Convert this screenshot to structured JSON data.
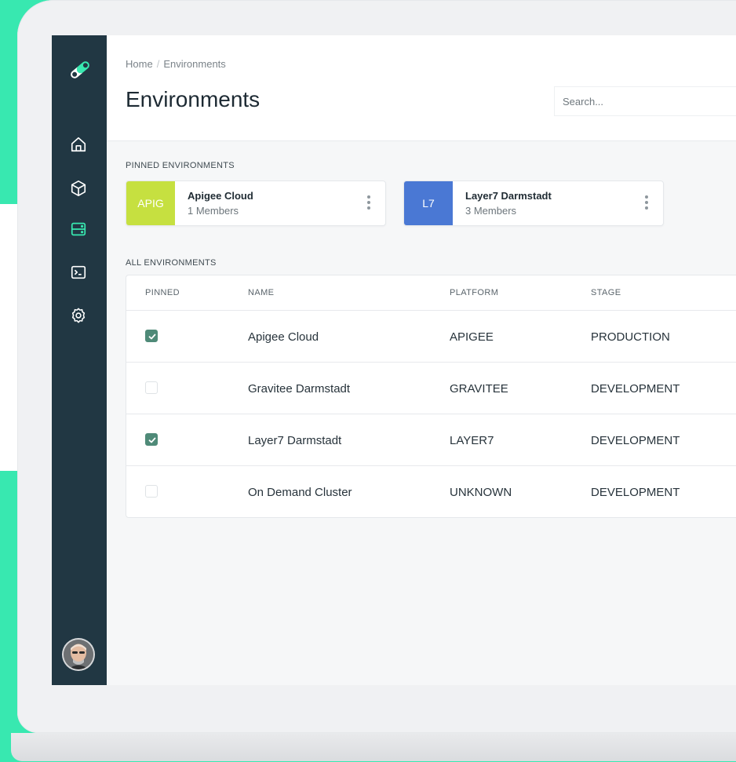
{
  "breadcrumb": {
    "home": "Home",
    "separator": "/",
    "current": "Environments"
  },
  "page": {
    "title": "Environments"
  },
  "search": {
    "placeholder": "Search..."
  },
  "sidebar": {
    "items": [
      {
        "icon": "home-icon"
      },
      {
        "icon": "cube-icon"
      },
      {
        "icon": "server-icon",
        "active": true
      },
      {
        "icon": "terminal-icon"
      },
      {
        "icon": "settings-icon"
      }
    ]
  },
  "pinned": {
    "label": "PINNED ENVIRONMENTS",
    "cards": [
      {
        "badge": "APIG",
        "name": "Apigee Cloud",
        "members": "1 Members",
        "color": "#c6e040"
      },
      {
        "badge": "L7",
        "name": "Layer7 Darmstadt",
        "members": "3 Members",
        "color": "#4a78d4"
      }
    ]
  },
  "all": {
    "label": "ALL ENVIRONMENTS",
    "columns": [
      "PINNED",
      "NAME",
      "PLATFORM",
      "STAGE"
    ],
    "rows": [
      {
        "pinned": true,
        "name": "Apigee Cloud",
        "platform": "APIGEE",
        "stage": "PRODUCTION"
      },
      {
        "pinned": false,
        "name": "Gravitee Darmstadt",
        "platform": "GRAVITEE",
        "stage": "DEVELOPMENT"
      },
      {
        "pinned": true,
        "name": "Layer7 Darmstadt",
        "platform": "LAYER7",
        "stage": "DEVELOPMENT"
      },
      {
        "pinned": false,
        "name": "On Demand Cluster",
        "platform": "UNKNOWN",
        "stage": "DEVELOPMENT"
      }
    ]
  },
  "colors": {
    "accent": "#38e8b0",
    "sidebar": "#213743",
    "checked": "#4f8a78"
  }
}
